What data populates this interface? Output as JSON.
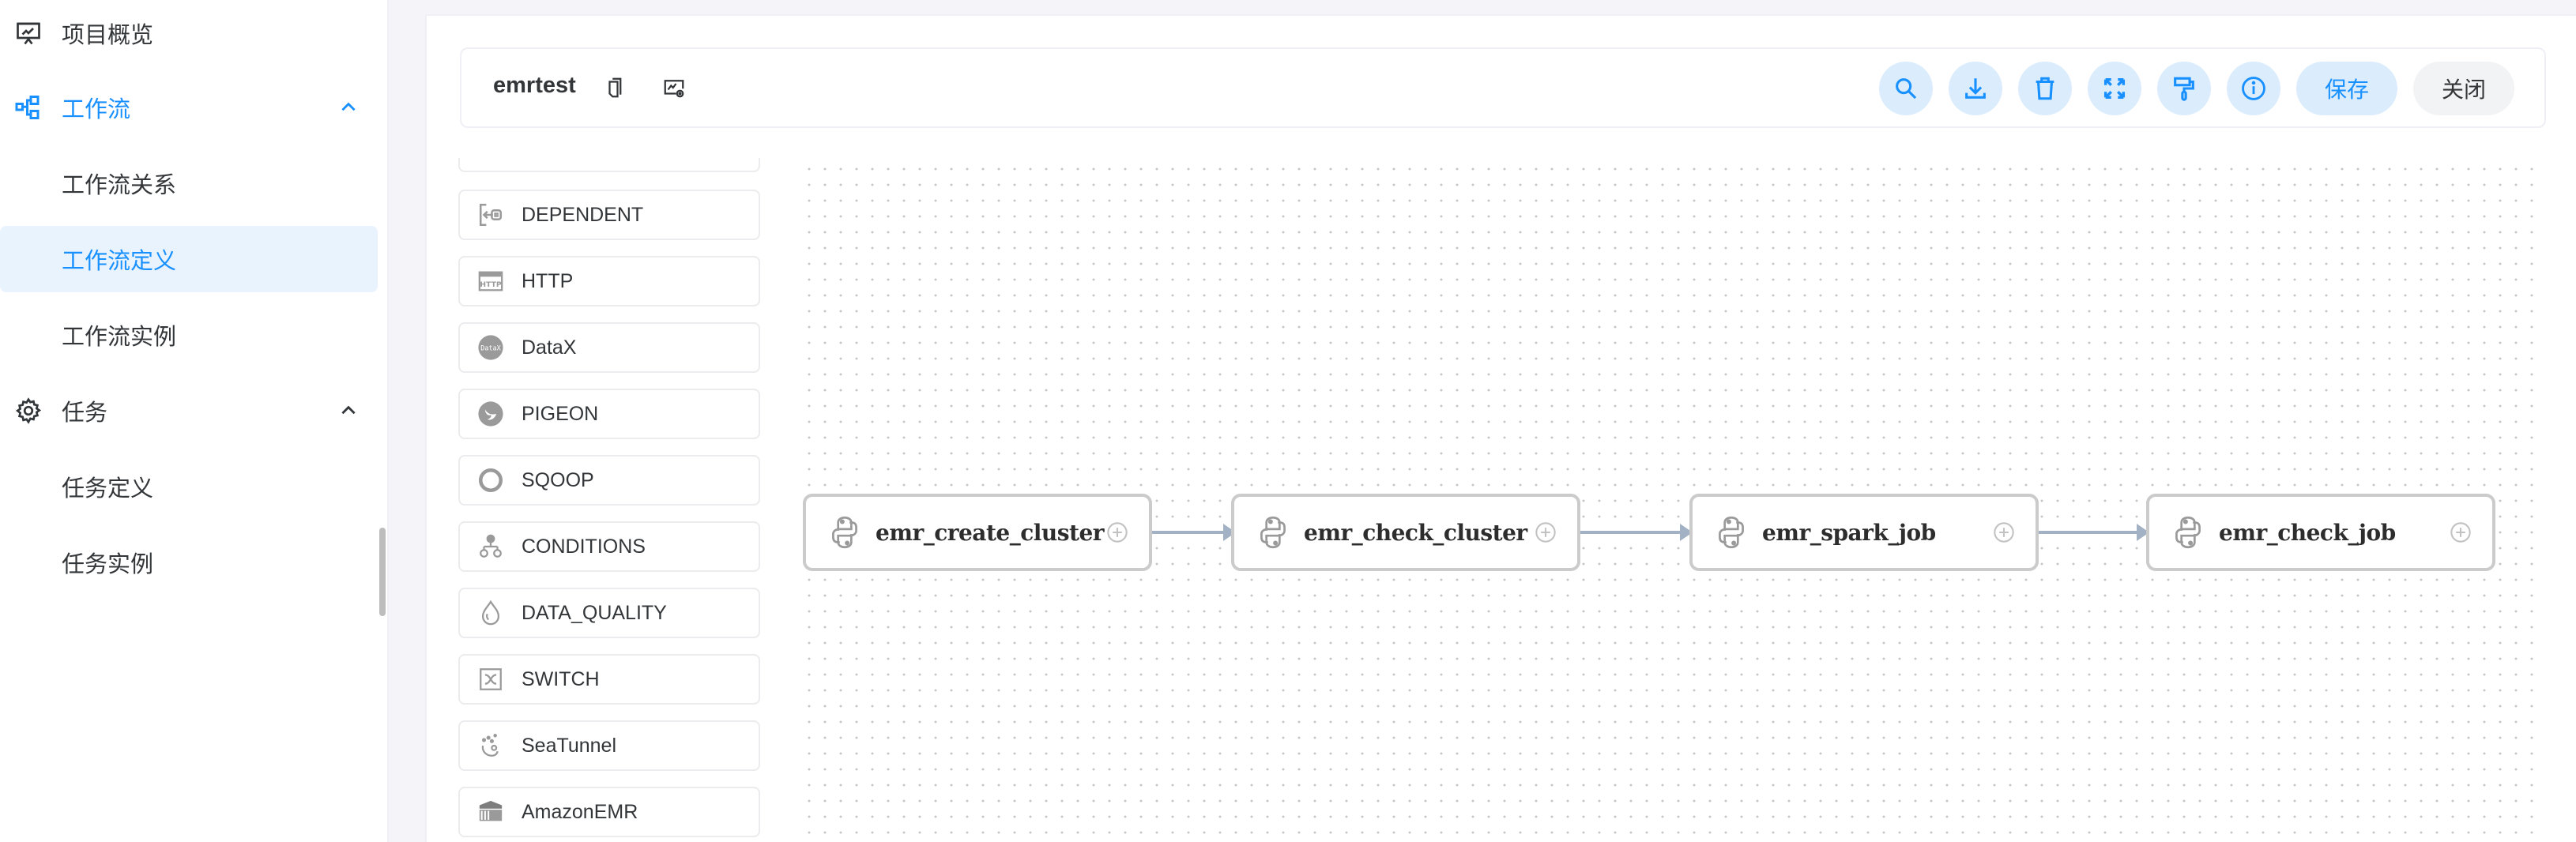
{
  "sidebar": {
    "items": [
      {
        "label": "项目概览",
        "icon": "presentation-chart-icon",
        "type": "group"
      },
      {
        "label": "工作流",
        "icon": "workflow-tree-icon",
        "type": "group",
        "expanded": true,
        "active": true
      },
      {
        "label": "工作流关系",
        "type": "child"
      },
      {
        "label": "工作流定义",
        "type": "child",
        "selected": true
      },
      {
        "label": "工作流实例",
        "type": "child"
      },
      {
        "label": "任务",
        "icon": "gear-icon",
        "type": "group",
        "expanded": true
      },
      {
        "label": "任务定义",
        "type": "child"
      },
      {
        "label": "任务实例",
        "type": "child"
      }
    ]
  },
  "toolbar": {
    "title": "emrtest",
    "icons": [
      "copy-icon",
      "view-variables-icon"
    ],
    "buttons": [
      {
        "name": "search",
        "icon": "search-icon"
      },
      {
        "name": "download",
        "icon": "download-icon"
      },
      {
        "name": "delete",
        "icon": "trash-icon"
      },
      {
        "name": "fullscreen",
        "icon": "fullscreen-icon"
      },
      {
        "name": "format",
        "icon": "paint-roller-icon"
      },
      {
        "name": "info",
        "icon": "info-icon"
      }
    ],
    "save_label": "保存",
    "close_label": "关闭"
  },
  "palette": {
    "items": [
      {
        "label": "",
        "icon": ""
      },
      {
        "label": "DEPENDENT",
        "icon": "dependent-icon"
      },
      {
        "label": "HTTP",
        "icon": "http-icon"
      },
      {
        "label": "DataX",
        "icon": "datax-icon"
      },
      {
        "label": "PIGEON",
        "icon": "pigeon-icon"
      },
      {
        "label": "SQOOP",
        "icon": "sqoop-icon"
      },
      {
        "label": "CONDITIONS",
        "icon": "conditions-icon"
      },
      {
        "label": "DATA_QUALITY",
        "icon": "data-quality-icon"
      },
      {
        "label": "SWITCH",
        "icon": "switch-icon"
      },
      {
        "label": "SeaTunnel",
        "icon": "seatunnel-icon"
      },
      {
        "label": "AmazonEMR",
        "icon": "amazon-emr-icon"
      }
    ]
  },
  "dag": {
    "nodes": [
      {
        "label": "emr_create_cluster",
        "icon": "python-icon"
      },
      {
        "label": "emr_check_cluster",
        "icon": "python-icon"
      },
      {
        "label": "emr_spark_job",
        "icon": "python-icon"
      },
      {
        "label": "emr_check_job",
        "icon": "python-icon"
      }
    ],
    "edges": [
      {
        "from": "emr_create_cluster",
        "to": "emr_check_cluster"
      },
      {
        "from": "emr_check_cluster",
        "to": "emr_spark_job"
      },
      {
        "from": "emr_spark_job",
        "to": "emr_check_job"
      }
    ]
  },
  "colors": {
    "accent": "#1890ff",
    "accent_bg": "#dbecfd",
    "selected_bg": "#e8f3fe",
    "text": "#333639",
    "node_border": "#cbcbcb",
    "edge": "#a2b1c3"
  }
}
